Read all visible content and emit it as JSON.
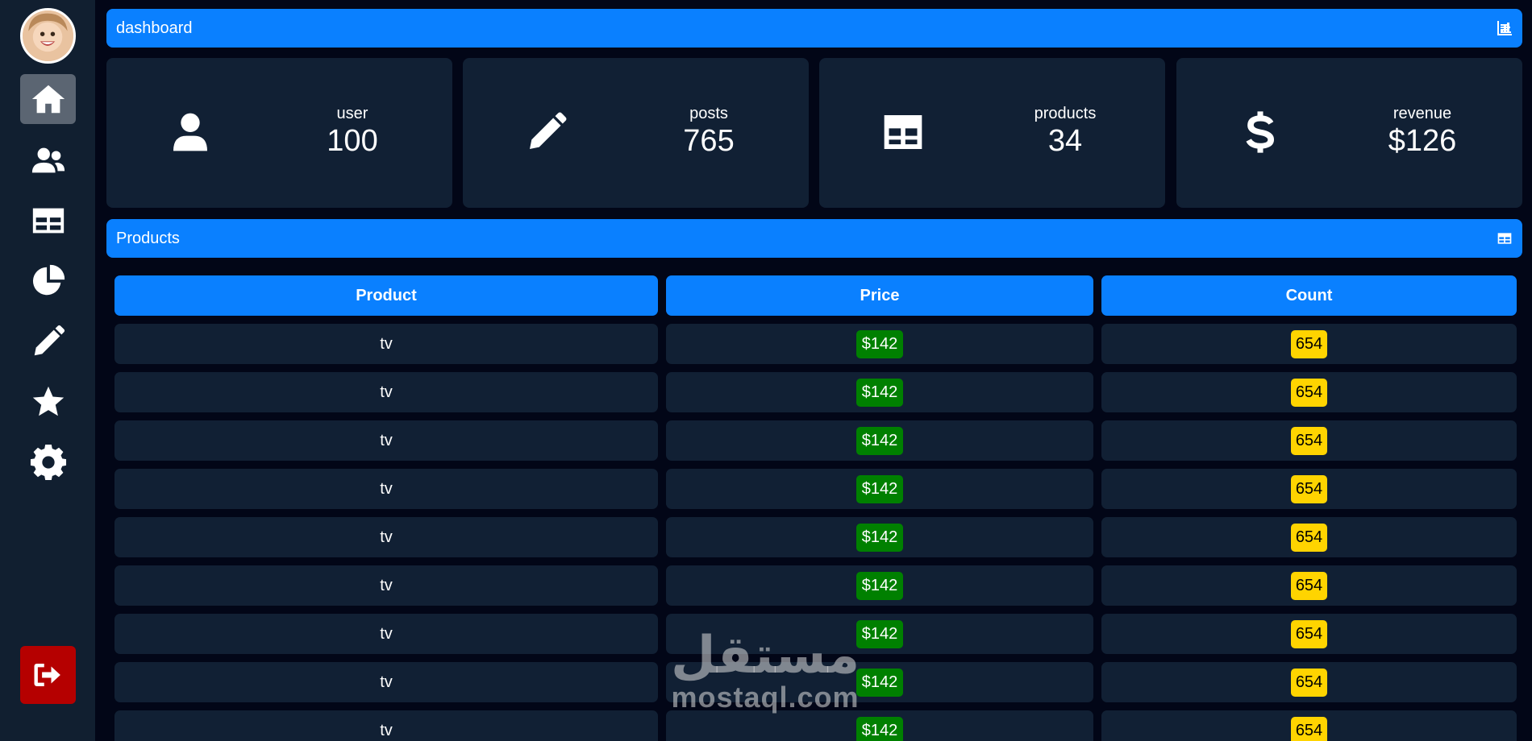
{
  "sidebar": {
    "items": [
      {
        "icon": "home-icon"
      },
      {
        "icon": "users-icon"
      },
      {
        "icon": "table-icon"
      },
      {
        "icon": "pie-chart-icon"
      },
      {
        "icon": "pencil-icon"
      },
      {
        "icon": "star-icon"
      },
      {
        "icon": "gear-icon"
      }
    ],
    "logout_icon": "logout-icon"
  },
  "header": {
    "title": "dashboard"
  },
  "stats": [
    {
      "label": "user",
      "value": "100",
      "icon": "user-icon"
    },
    {
      "label": "posts",
      "value": "765",
      "icon": "pencil-icon"
    },
    {
      "label": "products",
      "value": "34",
      "icon": "table-icon"
    },
    {
      "label": "revenue",
      "value": "$126",
      "icon": "dollar-icon"
    }
  ],
  "products_section": {
    "title": "Products"
  },
  "table": {
    "headers": [
      "Product",
      "Price",
      "Count"
    ],
    "rows": [
      {
        "product": "tv",
        "price": "$142",
        "count": "654"
      },
      {
        "product": "tv",
        "price": "$142",
        "count": "654"
      },
      {
        "product": "tv",
        "price": "$142",
        "count": "654"
      },
      {
        "product": "tv",
        "price": "$142",
        "count": "654"
      },
      {
        "product": "tv",
        "price": "$142",
        "count": "654"
      },
      {
        "product": "tv",
        "price": "$142",
        "count": "654"
      },
      {
        "product": "tv",
        "price": "$142",
        "count": "654"
      },
      {
        "product": "tv",
        "price": "$142",
        "count": "654"
      },
      {
        "product": "tv",
        "price": "$142",
        "count": "654"
      }
    ]
  },
  "watermark": {
    "arabic": "مستقل",
    "latin": "mostaql.com"
  },
  "colors": {
    "accent": "#0a80ff",
    "background": "#020617",
    "panel": "#112034",
    "price_badge": "#008000",
    "count_badge": "#ffd400",
    "logout": "#b50000"
  }
}
